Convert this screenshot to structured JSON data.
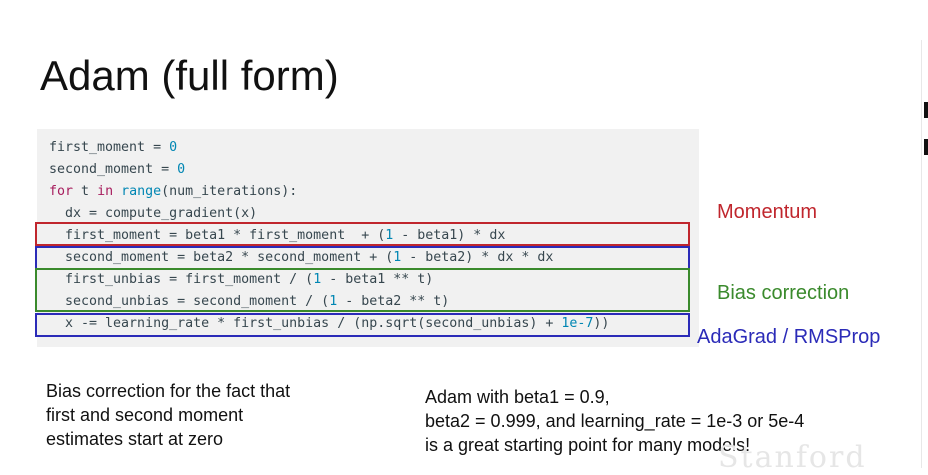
{
  "slide": {
    "title": "Adam (full form)",
    "watermark": "Stanford"
  },
  "code": {
    "l1": {
      "a": "first_moment = ",
      "b": "0"
    },
    "l2": {
      "a": "second_moment = ",
      "b": "0"
    },
    "l3": {
      "kw": "for",
      "a": " t ",
      "kw2": "in",
      "sp": " ",
      "bi": "range",
      "b": "(num_iterations):"
    },
    "l4": {
      "a": "  dx = compute_gradient(x)"
    },
    "l5": {
      "a": "  first_moment = beta1 * first_moment  + (",
      "n1": "1",
      "b": " - beta1) * dx"
    },
    "l6": {
      "a": "  second_moment = beta2 * second_moment + (",
      "n1": "1",
      "b": " - beta2) * dx * dx"
    },
    "l7": {
      "a": "  first_unbias = first_moment / (",
      "n1": "1",
      "b": " - beta1 ** t)"
    },
    "l8": {
      "a": "  second_unbias = second_moment / (",
      "n1": "1",
      "b": " - beta2 ** t)"
    },
    "l9": {
      "a": "  x -= learning_rate * first_unbias / (np.sqrt(second_unbias) + ",
      "n1": "1e-7",
      "b": "))"
    }
  },
  "labels": {
    "momentum": "Momentum",
    "bias_correction": "Bias correction",
    "adagrad": "AdaGrad / RMSProp"
  },
  "notes": {
    "left": [
      "Bias correction for the fact that",
      "first and second moment",
      "estimates start at zero"
    ],
    "right": [
      "Adam with beta1 = 0.9,",
      "beta2 = 0.999, and learning_rate = 1e-3 or 5e-4",
      "is a great starting point for many models!"
    ]
  },
  "colors": {
    "momentum": "#c0262d",
    "bias_correction": "#3a8a2c",
    "adagrad": "#2b2bb8",
    "keyword": "#a71d5d",
    "number": "#0086b3"
  }
}
